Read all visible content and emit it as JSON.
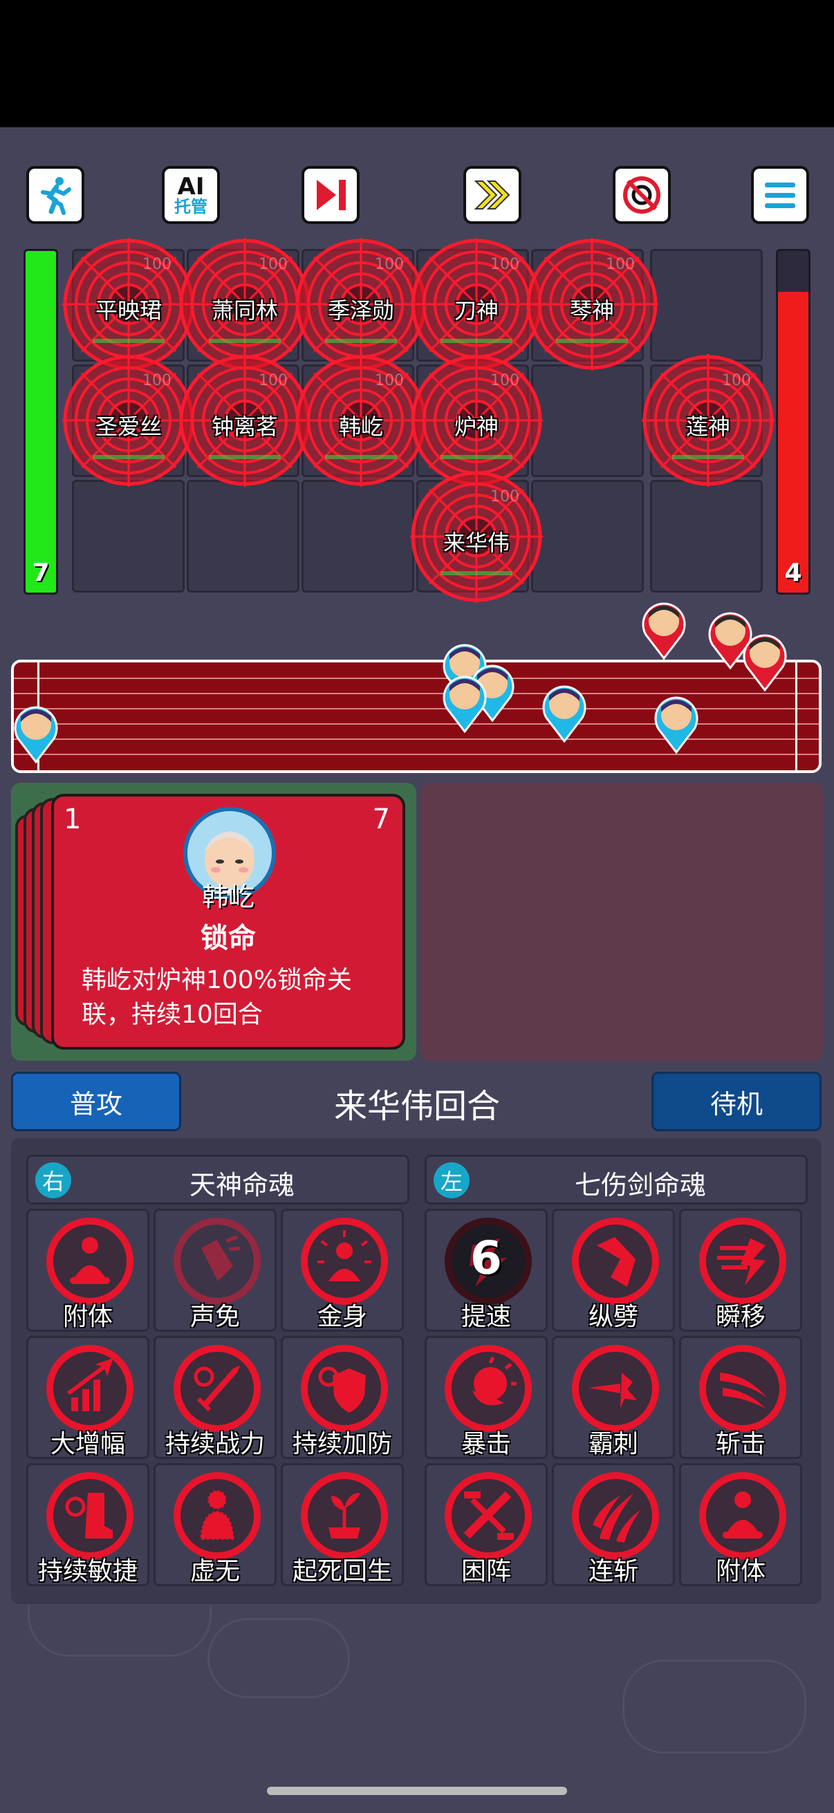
{
  "toolbar": {
    "ai_label_top": "AI",
    "ai_label_bottom": "托管"
  },
  "left_energy": 7,
  "right_energy": 4,
  "units": {
    "u1": "平映珺",
    "u2": "萧同林",
    "u3": "季泽勋",
    "u4": "刀神",
    "u5": "琴神",
    "u6": "圣爱丝",
    "u7": "钟离茗",
    "u8": "韩屹",
    "u9": "炉神",
    "u10": "莲神",
    "u11": "来华伟"
  },
  "unit_hp": "100",
  "card": {
    "cost": "1",
    "count": "7",
    "character": "韩屹",
    "skill": "锁命",
    "desc_line1": "韩屹对炉神100%锁命关",
    "desc_line2": "联，持续10回合"
  },
  "actions": {
    "attack": "普攻",
    "turn": "来华伟回合",
    "wait": "待机"
  },
  "souls": {
    "right_tag": "右",
    "right_name": "天神命魂",
    "left_tag": "左",
    "left_name": "七伤剑命魂"
  },
  "skills_right": [
    {
      "label": "附体",
      "icon": "meditate-icon"
    },
    {
      "label": "声免",
      "icon": "sound-immune-icon"
    },
    {
      "label": "金身",
      "icon": "golden-body-icon"
    },
    {
      "label": "大增幅",
      "icon": "amplify-icon"
    },
    {
      "label": "持续战力",
      "icon": "sword-refresh-icon"
    },
    {
      "label": "持续加防",
      "icon": "shield-refresh-icon"
    },
    {
      "label": "持续敏捷",
      "icon": "boot-refresh-icon"
    },
    {
      "label": "虚无",
      "icon": "void-figure-icon"
    },
    {
      "label": "起死回生",
      "icon": "revive-sprout-icon"
    }
  ],
  "skills_left": [
    {
      "label": "提速",
      "icon": "speed-up-icon",
      "cooldown": "6"
    },
    {
      "label": "纵劈",
      "icon": "vertical-slash-icon"
    },
    {
      "label": "瞬移",
      "icon": "teleport-icon"
    },
    {
      "label": "暴击",
      "icon": "critical-hit-icon"
    },
    {
      "label": "霸刺",
      "icon": "thrust-icon"
    },
    {
      "label": "斩击",
      "icon": "slash-icon"
    },
    {
      "label": "困阵",
      "icon": "trap-formation-icon"
    },
    {
      "label": "连斩",
      "icon": "combo-slash-icon"
    },
    {
      "label": "附体",
      "icon": "meditate-icon"
    }
  ],
  "colors": {
    "accent_red": "#e8142c",
    "hp_green": "#22e81a",
    "hp_red": "#f01c1c",
    "blue_button": "#1763b8",
    "dark_blue_button": "#0f4a8a"
  }
}
